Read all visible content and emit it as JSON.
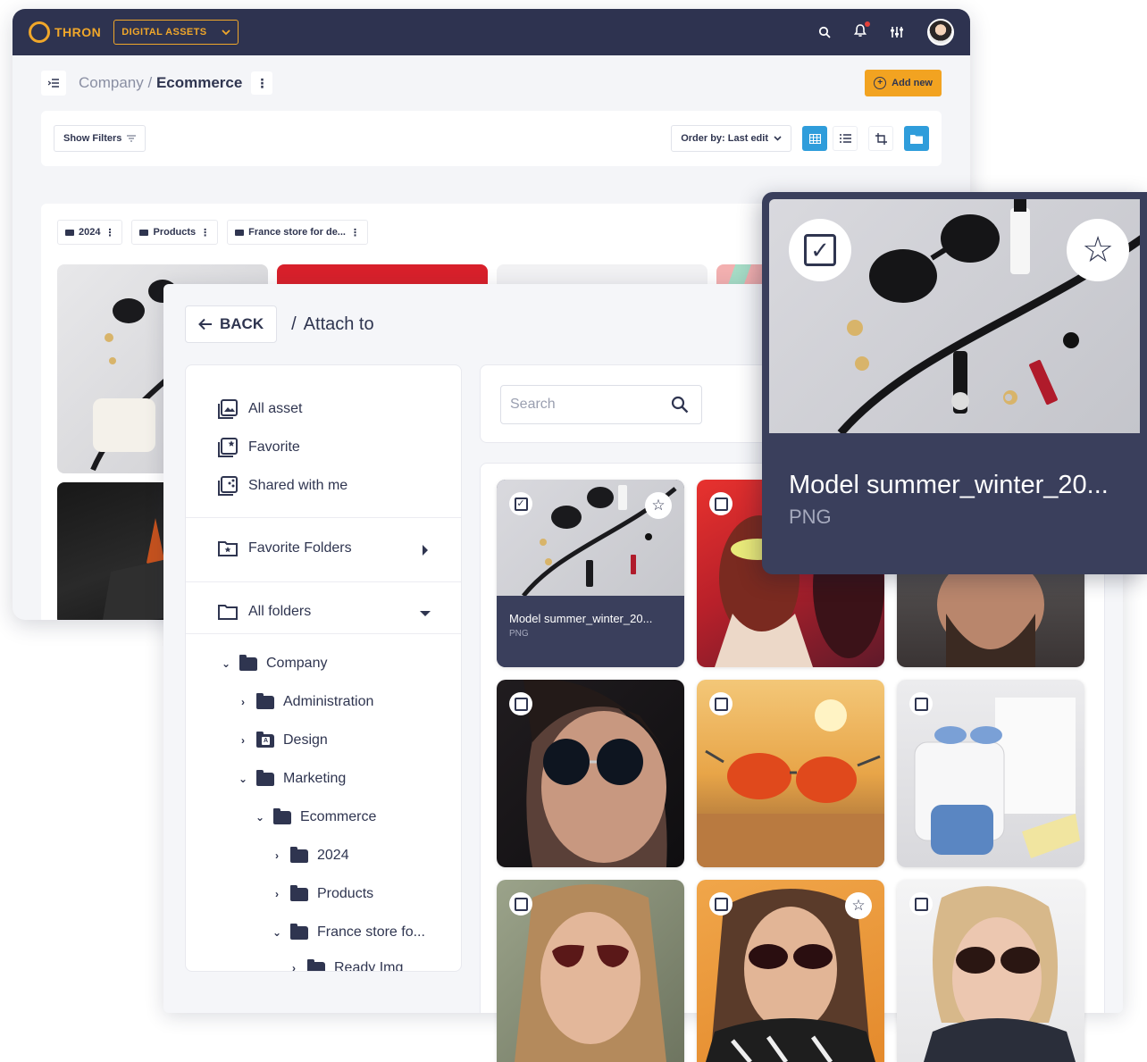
{
  "header": {
    "logo_text": "THRON",
    "app_select": "DIGITAL ASSETS"
  },
  "breadcrumb": {
    "parent": "Company /",
    "current": "Ecommerce"
  },
  "toolbar": {
    "add_label": "Add new",
    "show_filters": "Show Filters",
    "order_by": "Order by: Last edit"
  },
  "folder_chips": [
    {
      "label": "2024"
    },
    {
      "label": "Products"
    },
    {
      "label": "France store for de..."
    }
  ],
  "attach": {
    "back_label": "BACK",
    "title": "Attach to"
  },
  "sidebar": {
    "items": [
      {
        "label": "All asset"
      },
      {
        "label": "Favorite"
      },
      {
        "label": "Shared with me"
      },
      {
        "label": "Favorite Folders"
      },
      {
        "label": "All folders"
      }
    ],
    "tree": [
      {
        "label": "Company",
        "expanded": true
      },
      {
        "label": "Administration",
        "expanded": false
      },
      {
        "label": "Design",
        "expanded": false
      },
      {
        "label": "Marketing",
        "expanded": true
      },
      {
        "label": "Ecommerce",
        "expanded": true
      },
      {
        "label": "2024",
        "expanded": false
      },
      {
        "label": "Products",
        "expanded": false
      },
      {
        "label": "France store fo...",
        "expanded": true
      },
      {
        "label": "Ready Img",
        "expanded": false
      }
    ]
  },
  "search": {
    "placeholder": "Search"
  },
  "assets": [
    {
      "name": "Model summer_winter_20...",
      "type": "PNG",
      "selected": true,
      "favorite": true
    },
    {
      "name": "",
      "type": "",
      "selected": false,
      "favorite": false
    },
    {
      "name": "",
      "type": "",
      "selected": false,
      "favorite": false
    },
    {
      "name": "",
      "type": "",
      "selected": false,
      "favorite": false
    },
    {
      "name": "",
      "type": "",
      "selected": false,
      "favorite": false
    },
    {
      "name": "",
      "type": "",
      "selected": false,
      "favorite": false
    },
    {
      "name": "",
      "type": "",
      "selected": false,
      "favorite": false
    },
    {
      "name": "",
      "type": "",
      "selected": false,
      "favorite": true
    },
    {
      "name": "",
      "type": "",
      "selected": false,
      "favorite": false
    }
  ],
  "zoom": {
    "name": "Model summer_winter_20...",
    "type": "PNG"
  },
  "colors": {
    "navy": "#2e3350",
    "accent_orange": "#f2a321",
    "accent_blue": "#2f9ddb",
    "card_caption": "#3a3f5c"
  }
}
